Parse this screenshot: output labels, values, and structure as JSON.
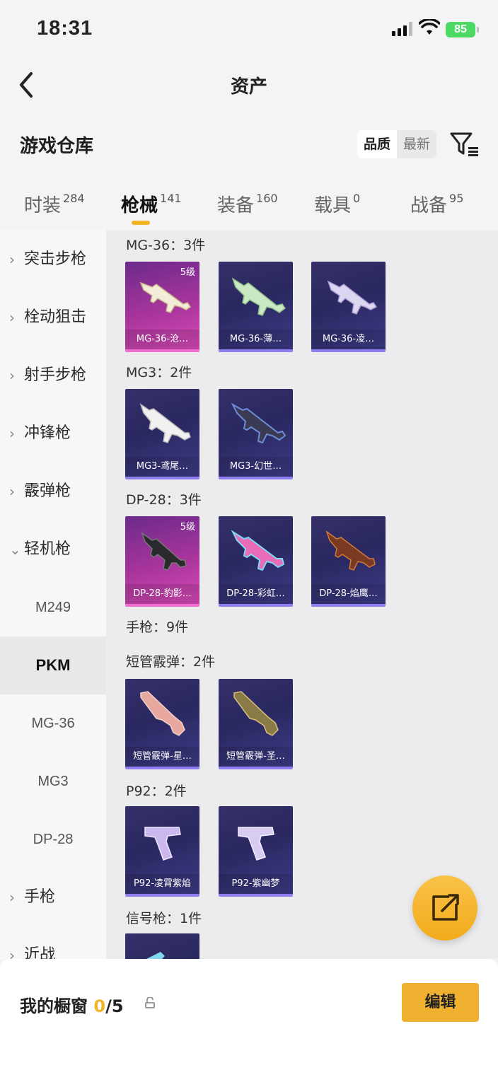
{
  "status": {
    "time": "18:31",
    "battery": "85"
  },
  "nav": {
    "title": "资产"
  },
  "warehouse": {
    "title": "游戏仓库",
    "sort_quality": "品质",
    "sort_latest": "最新"
  },
  "tabs": [
    {
      "label": "时装",
      "count": "284"
    },
    {
      "label": "枪械",
      "count": "141"
    },
    {
      "label": "装备",
      "count": "160"
    },
    {
      "label": "载具",
      "count": "0"
    },
    {
      "label": "战备",
      "count": "95"
    }
  ],
  "sidebar": {
    "categories": [
      "突击步枪",
      "栓动狙击",
      "射手步枪",
      "冲锋枪",
      "霰弹枪",
      "轻机枪"
    ],
    "subs": [
      "M249",
      "PKM",
      "MG-36",
      "MG3",
      "DP-28"
    ],
    "after": [
      "手枪",
      "近战"
    ]
  },
  "groups": [
    {
      "title": "MG-36：3件",
      "items": [
        {
          "name": "MG-36-沧…",
          "level": "5级"
        },
        {
          "name": "MG-36-薄…"
        },
        {
          "name": "MG-36-凌…"
        }
      ]
    },
    {
      "title": "MG3：2件",
      "items": [
        {
          "name": "MG3-鸢尾…"
        },
        {
          "name": "MG3-幻世…"
        }
      ]
    },
    {
      "title": "DP-28：3件",
      "items": [
        {
          "name": "DP-28-豹影…",
          "level": "5级"
        },
        {
          "name": "DP-28-彩虹…"
        },
        {
          "name": "DP-28-焰鹰…"
        }
      ]
    },
    {
      "title": "手枪：9件"
    },
    {
      "title": "短管霰弹：2件",
      "items": [
        {
          "name": "短管霰弹-星…"
        },
        {
          "name": "短管霰弹-圣…"
        }
      ]
    },
    {
      "title": "P92：2件",
      "items": [
        {
          "name": "P92-凌霄紫焰"
        },
        {
          "name": "P92-紫幽梦"
        }
      ]
    },
    {
      "title": "信号枪：1件"
    }
  ],
  "showcase": {
    "label": "我的橱窗",
    "current": "0",
    "total": "/5",
    "edit": "编辑"
  },
  "colors": {
    "accent": "#f0b428",
    "card_purple": "#2a2860",
    "card_pink": "#a8359c"
  }
}
